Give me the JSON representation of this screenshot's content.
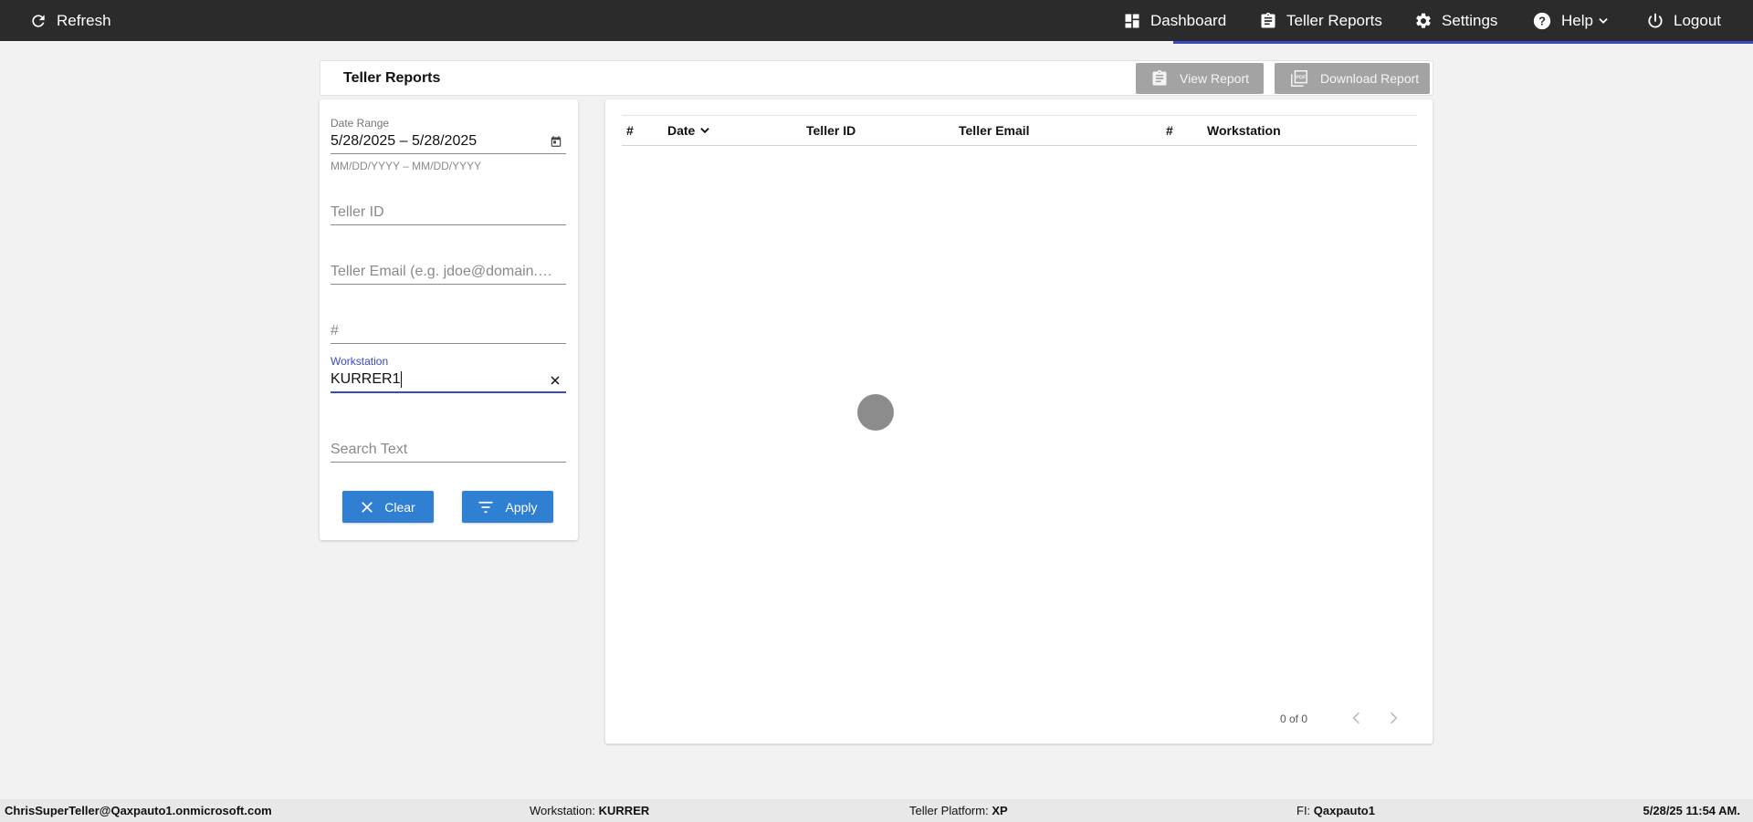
{
  "topbar": {
    "refresh_label": "Refresh",
    "dashboard_label": "Dashboard",
    "teller_reports_label": "Teller Reports",
    "settings_label": "Settings",
    "help_label": "Help",
    "logout_label": "Logout"
  },
  "header": {
    "title": "Teller Reports",
    "view_report_label": "View Report",
    "download_report_label": "Download Report"
  },
  "filters": {
    "date_range_label": "Date Range",
    "date_range_value": "5/28/2025 – 5/28/2025",
    "date_range_hint": "MM/DD/YYYY – MM/DD/YYYY",
    "teller_id_placeholder": "Teller ID",
    "teller_email_placeholder": "Teller Email (e.g. jdoe@domain.com)",
    "number_placeholder": "#",
    "workstation_label": "Workstation",
    "workstation_value": "KURRER1",
    "search_text_placeholder": "Search Text",
    "clear_label": "Clear",
    "apply_label": "Apply"
  },
  "table": {
    "columns": [
      "#",
      "Date",
      "Teller ID",
      "Teller Email",
      "#",
      "Workstation"
    ],
    "rows": [],
    "pager_text": "0 of 0"
  },
  "status": {
    "user": "ChrisSuperTeller@Qaxpauto1.onmicrosoft.com",
    "workstation_label": "Workstation:",
    "workstation_value": "KURRER",
    "platform_label": "Teller Platform:",
    "platform_value": "XP",
    "fi_label": "FI:",
    "fi_value": "Qaxpauto1",
    "datetime": "5/28/25 11:54 AM."
  },
  "colors": {
    "topbar_bg": "#2b2b2b",
    "accent": "#3a4bc0",
    "primary_button": "#2f7fd3",
    "disabled_button": "#a3a3a3"
  }
}
